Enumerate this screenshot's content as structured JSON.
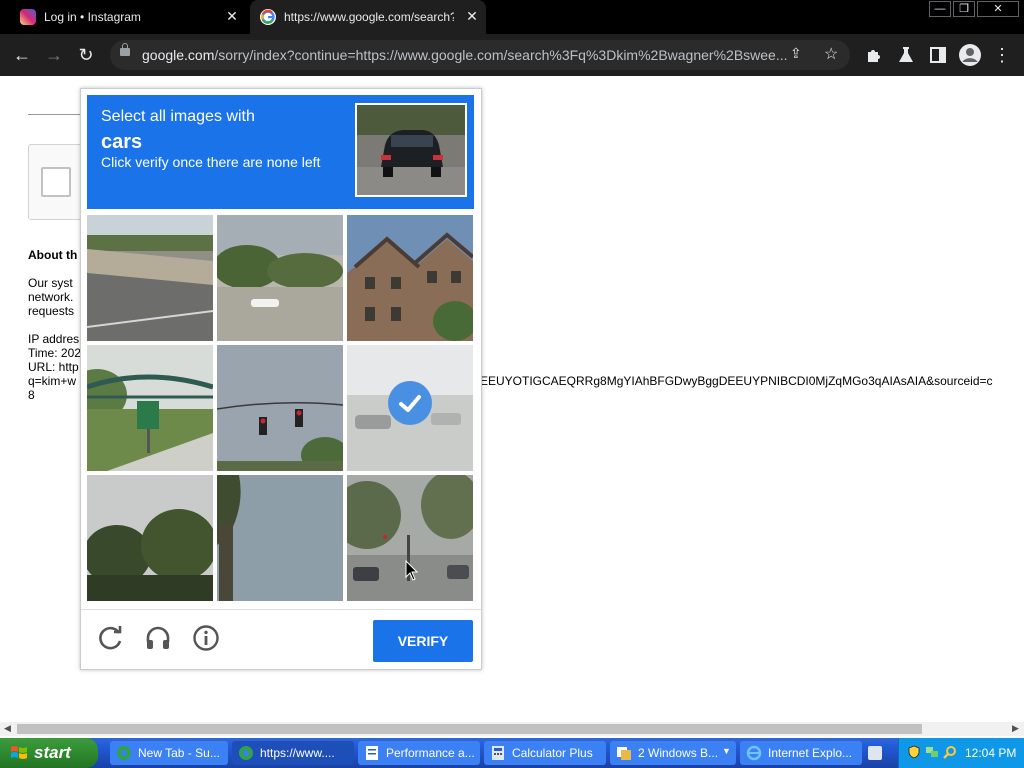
{
  "browser": {
    "tabs": [
      {
        "title": "Log in • Instagram"
      },
      {
        "title": "https://www.google.com/search?q"
      }
    ],
    "url_host": "google.com",
    "url_path": "/sorry/index?continue=https://www.google.com/search%3Fq%3Dkim%2Bwagner%2Bswee..."
  },
  "page": {
    "about_heading": "About th",
    "body_line1": "Our syst",
    "body_line2": "network.",
    "body_line3": "requests",
    "ip_line": "IP addres",
    "time_line": "Time: 202",
    "url_line": "URL: http",
    "query_line_start": "q=kim+w",
    "query_line_end": "EEUYOTIGCAEQRRg8MgYIAhBFGDwyBggDEEUYPNIBCDI0MjZqMGo3qAIAsAIA&sourceid=c",
    "last_line": "8"
  },
  "captcha": {
    "instruction_line1": "Select all images with",
    "instruction_object": "cars",
    "instruction_line3": "Click verify once there are none left",
    "tiles": [
      {
        "name": "roadside-rocks",
        "selected": false
      },
      {
        "name": "trees-white-car",
        "selected": false
      },
      {
        "name": "townhouses",
        "selected": false
      },
      {
        "name": "footbridge-sign",
        "selected": false
      },
      {
        "name": "traffic-lights",
        "selected": false
      },
      {
        "name": "faded-parking-lot",
        "selected": true
      },
      {
        "name": "palm-trees",
        "selected": false
      },
      {
        "name": "palm-and-sky",
        "selected": false
      },
      {
        "name": "street-intersection",
        "selected": false
      }
    ],
    "verify_label": "VERIFY"
  },
  "taskbar": {
    "start_label": "start",
    "items": [
      {
        "label": "New Tab - Su...",
        "active": false
      },
      {
        "label": "https://www....",
        "active": true
      },
      {
        "label": "Performance a...",
        "active": false
      },
      {
        "label": "Calculator Plus",
        "active": false
      },
      {
        "label": "2 Windows B...",
        "active": false
      },
      {
        "label": "Internet Explo...",
        "active": false
      }
    ],
    "clock": "12:04 PM"
  },
  "colors": {
    "accent": "#1a73e8",
    "browser_dark": "#1f1f1f",
    "taskbar_blue": "#245edb",
    "start_green": "#2f8a2f"
  }
}
